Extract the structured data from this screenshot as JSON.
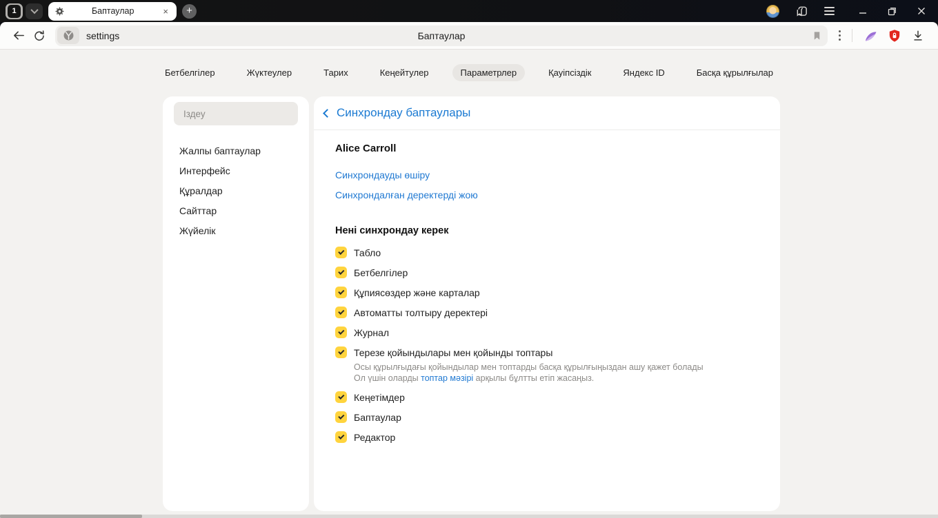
{
  "titlebar": {
    "tab_group_count": "1",
    "tab_title": "Баптаулар",
    "close_tab_glyph": "×",
    "new_tab_glyph": "+"
  },
  "toolbar": {
    "url": "settings",
    "page_title": "Баптаулар"
  },
  "navtabs": {
    "items": [
      {
        "label": "Бетбелгілер"
      },
      {
        "label": "Жүктеулер"
      },
      {
        "label": "Тарих"
      },
      {
        "label": "Кеңейтулер"
      },
      {
        "label": "Параметрлер"
      },
      {
        "label": "Қауіпсіздік"
      },
      {
        "label": "Яндекс ID"
      },
      {
        "label": "Басқа құрылғылар"
      }
    ],
    "active": "Параметрлер"
  },
  "sidebar": {
    "search_placeholder": "Іздеу",
    "items": [
      {
        "label": "Жалпы баптаулар"
      },
      {
        "label": "Интерфейс"
      },
      {
        "label": "Құралдар"
      },
      {
        "label": "Сайттар"
      },
      {
        "label": "Жүйелік"
      }
    ]
  },
  "sync": {
    "header": "Синхрондау баптаулары",
    "account_name": "Alice Carroll",
    "links": [
      "Синхрондауды өшіру",
      "Синхрондалған деректерді жою"
    ],
    "section_title": "Нені синхрондау керек",
    "items": [
      {
        "label": "Табло",
        "checked": true
      },
      {
        "label": "Бетбелгілер",
        "checked": true
      },
      {
        "label": "Құпиясөздер және карталар",
        "checked": true
      },
      {
        "label": "Автоматты толтыру деректері",
        "checked": true
      },
      {
        "label": "Журнал",
        "checked": true
      },
      {
        "label": "Терезе қойындылары мен қойынды топтары",
        "checked": true,
        "desc_line1": "Осы құрылғыдағы қойындылар мен топтарды басқа құрылғыңыздан ашу қажет болады",
        "desc_line2_prefix": "Ол үшін оларды ",
        "desc_link": "топтар мәзірі",
        "desc_line2_suffix": " арқылы бұлтты етіп жасаңыз."
      },
      {
        "label": "Кеңетімдер",
        "checked": true
      },
      {
        "label": "Баптаулар",
        "checked": true
      },
      {
        "label": "Редактор",
        "checked": true
      }
    ]
  },
  "colors": {
    "accent_yellow": "#ffd43e",
    "link_blue": "#2079d2",
    "header_blue": "#1b7ad2",
    "shield_red": "#e2261d",
    "feather_purple": "#9b6fd6"
  }
}
